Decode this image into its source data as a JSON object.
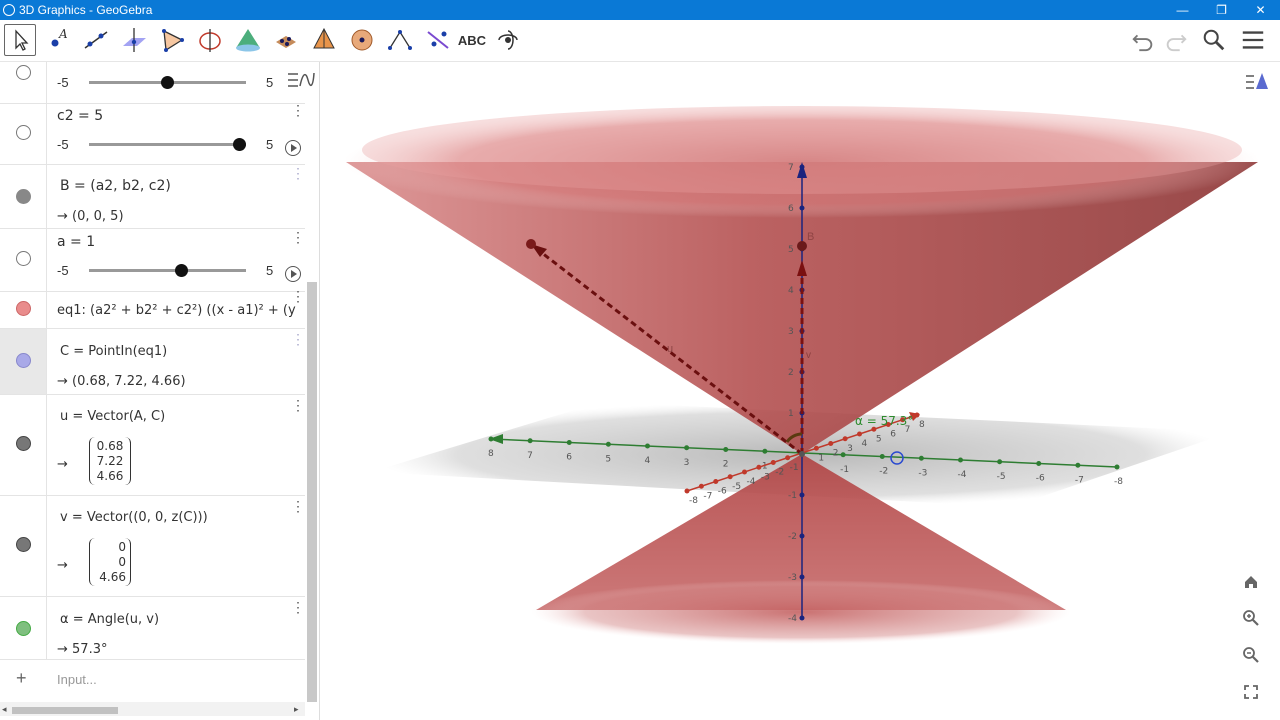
{
  "window": {
    "title": "3D Graphics - GeoGebra",
    "minimize": "—",
    "maximize": "❐",
    "close": "✕"
  },
  "toolbar": {
    "tools": [
      {
        "name": "move-tool",
        "icon": "arrow-icon"
      },
      {
        "name": "point-tool",
        "icon": "point-icon"
      },
      {
        "name": "line-tool",
        "icon": "line-icon"
      },
      {
        "name": "perpendicular-tool",
        "icon": "perpendicular-line-icon"
      },
      {
        "name": "polygon-tool",
        "icon": "polygon-icon"
      },
      {
        "name": "circle-tool",
        "icon": "circle-axis-icon"
      },
      {
        "name": "plane-tool",
        "icon": "plane-icon"
      },
      {
        "name": "pyramid-tool",
        "icon": "prism-icon"
      },
      {
        "name": "pyramid-tool-2",
        "icon": "pyramid-icon"
      },
      {
        "name": "sphere-tool",
        "icon": "sphere-icon"
      },
      {
        "name": "angle-tool",
        "icon": "angle-icon"
      },
      {
        "name": "reflect-tool",
        "icon": "reflect-icon"
      },
      {
        "name": "text-tool",
        "label": "ABC"
      },
      {
        "name": "rotate-view-tool",
        "icon": "rotate-icon"
      }
    ],
    "undo": "undo-icon",
    "redo": "redo-icon",
    "search": "search-icon",
    "menu": "menu-icon"
  },
  "algebra": {
    "row0": {
      "min": "-5",
      "max": "5",
      "value": 0
    },
    "row1": {
      "label": "c2 = 5",
      "min": "-5",
      "max": "5",
      "value": 5
    },
    "row2": {
      "def": "B  =  (a2, b2, c2)",
      "out": "→  (0,  0,  5)"
    },
    "row3": {
      "label": "a = 1",
      "min": "-5",
      "max": "5",
      "value": 1
    },
    "row4": {
      "def": "eq1: (a2² + b2² + c2²) ((x - a1)² + (y"
    },
    "row5": {
      "def": "C  =  PointIn(eq1)",
      "out": "→  (0.68,  7.22,  4.66)"
    },
    "row6": {
      "def": "u  =  Vector(A, C)",
      "arrow": "→",
      "v1": "0.68",
      "v2": "7.22",
      "v3": "4.66"
    },
    "row7": {
      "def": "v  =  Vector((0, 0, z(C)))",
      "arrow": "→",
      "v1": "0",
      "v2": "0",
      "v3": "4.66"
    },
    "row8": {
      "def": "α  =  Angle(u, v)",
      "out": "→  57.3°"
    },
    "input": {
      "plus": "+",
      "placeholder": "Input..."
    },
    "colors": {
      "red": "#e98c8c",
      "blue": "#a9a9e8",
      "gray": "#777777",
      "green": "#7fbf7f"
    }
  },
  "graphics": {
    "axis_labels": {
      "y_ticks": [
        "8",
        "7",
        "6",
        "5",
        "4",
        "3",
        "2",
        "1",
        "-1",
        "-2",
        "-3",
        "-4",
        "-5",
        "-6",
        "-7",
        "-8"
      ],
      "x_ticks": [
        "-8",
        "-7",
        "-6",
        "-5",
        "-4",
        "-3",
        "-2",
        "-1",
        "1",
        "2",
        "3",
        "4",
        "5",
        "6",
        "7",
        "8"
      ],
      "z_ticks": [
        "7",
        "6",
        "5",
        "4",
        "3",
        "2",
        "1",
        "-1",
        "-2",
        "-3",
        "-4"
      ]
    },
    "angle_label": "α = 57.3°",
    "point_B": "B",
    "vector_u": "u",
    "vector_v": "v",
    "colors": {
      "cone": "#b23a3a",
      "x_axis": "#c0392b",
      "y_axis": "#2e7d32",
      "z_axis": "#1a237e"
    }
  }
}
